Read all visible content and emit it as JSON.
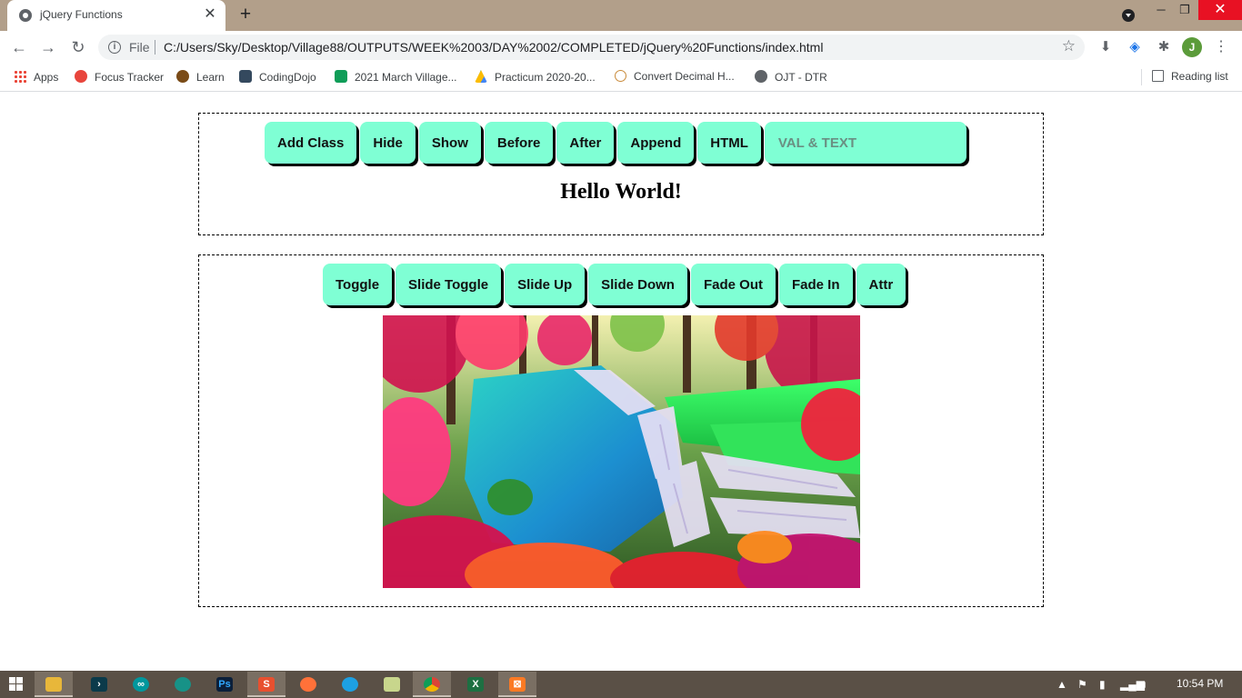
{
  "browser": {
    "tab_title": "jQuery Functions",
    "new_tab_symbol": "+",
    "omnibox": {
      "scheme_label": "File",
      "url": "C:/Users/Sky/Desktop/Village88/OUTPUTS/WEEK%2003/DAY%2002/COMPLETED/jQuery%20Functions/index.html"
    },
    "profile_initial": "J",
    "bookmarks": [
      {
        "label": "Apps",
        "icon": "apps-grid-icon",
        "color": "#ea4335"
      },
      {
        "label": "Focus Tracker",
        "icon": "focus-tracker-icon",
        "color": "#e8453c"
      },
      {
        "label": "Learn",
        "icon": "learn-icon",
        "color": "#7a4b17"
      },
      {
        "label": "CodingDojo",
        "icon": "codingdojo-icon",
        "color": "#34495e"
      },
      {
        "label": "2021 March Village...",
        "icon": "sheets-icon",
        "color": "#0f9d58"
      },
      {
        "label": "Practicum 2020-20...",
        "icon": "drive-icon",
        "color": "#fbbc04"
      },
      {
        "label": "Convert Decimal H...",
        "icon": "clock-favicon-icon",
        "color": "#c98b3b"
      },
      {
        "label": "OJT - DTR",
        "icon": "globe-icon",
        "color": "#5f6368"
      }
    ],
    "reading_list": "Reading list"
  },
  "page": {
    "top_buttons": [
      "Add Class",
      "Hide",
      "Show",
      "Before",
      "After",
      "Append",
      "HTML"
    ],
    "val_text_placeholder": "VAL & TEXT",
    "heading": "Hello World!",
    "bottom_buttons": [
      "Toggle",
      "Slide Toggle",
      "Slide Up",
      "Slide Down",
      "Fade Out",
      "Fade In",
      "Attr"
    ],
    "image_subject": "waterfall-landscape",
    "accent_color": "#7fffd4"
  },
  "taskbar": {
    "apps": [
      "file-explorer",
      "powershell",
      "arduino",
      "gitkraken",
      "photoshop",
      "sublime",
      "firefox",
      "edge",
      "file-manager",
      "chrome",
      "excel",
      "xampp"
    ],
    "clock": "10:54 PM"
  }
}
